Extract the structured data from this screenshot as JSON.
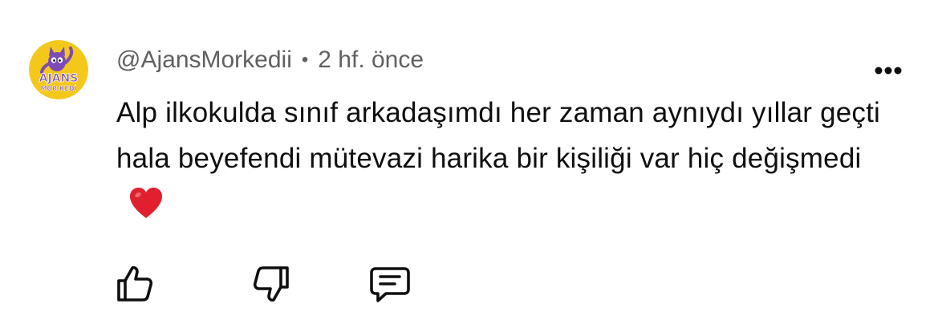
{
  "comment": {
    "author": "@AjansMorkedii",
    "separator": "•",
    "time": "2 hf. önce",
    "text": "Alp ilkokulda sınıf arkadaşımdı her zaman aynıydı yıllar geçti hala beyefendi mütevazi harika bir kişiliği var hiç değişmedi",
    "emoji": "heart-icon",
    "avatar": {
      "logo_text_line1": "AJANS",
      "logo_text_line2": "MOR KEDİ",
      "background_color": "#f3c81b"
    }
  },
  "actions": {
    "like_icon": "thumbs-up-icon",
    "dislike_icon": "thumbs-down-icon",
    "reply_icon": "reply-comment-icon",
    "more_icon": "more-options-icon"
  },
  "colors": {
    "text_primary": "#0f0f0f",
    "text_secondary": "#606060",
    "heart": "#e0202e"
  }
}
